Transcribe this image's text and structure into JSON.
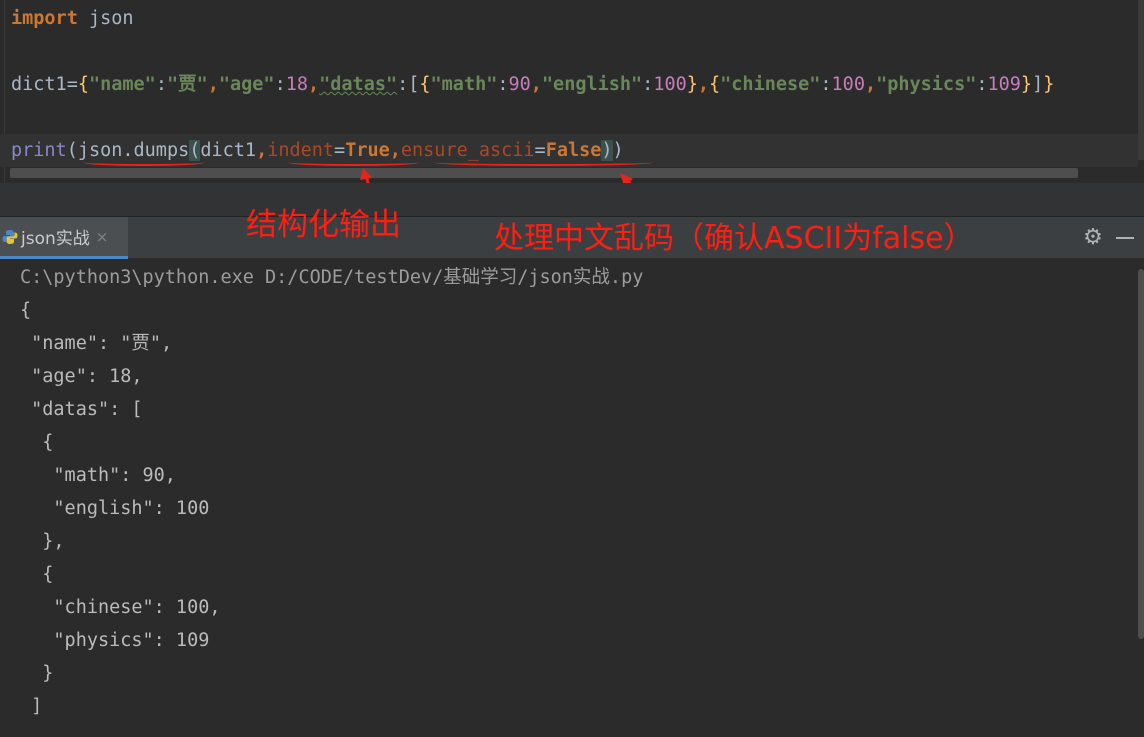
{
  "editor": {
    "line1": {
      "kw": "import",
      "mod": "json"
    },
    "line2": {
      "var": "dict1",
      "k_name": "\"name\"",
      "v_name": "\"贾\"",
      "k_age": "\"age\"",
      "v_age": "18",
      "k_datas": "\"datas\"",
      "k_math": "\"math\"",
      "v_math": "90",
      "k_english": "\"english\"",
      "v_english": "100",
      "k_chinese": "\"chinese\"",
      "v_chinese": "100",
      "k_physics": "\"physics\"",
      "v_physics": "109"
    },
    "line3": {
      "fn": "print",
      "call": "json.dumps",
      "arg": "dict1",
      "p_indent": "indent",
      "v_indent": "True",
      "p_ensure": "ensure_ascii",
      "v_ensure": "False"
    }
  },
  "annotations": {
    "structured_output": "结构化输出",
    "handle_chinese": "处理中文乱码（确认ASCII为false）",
    "color": "#ff1e12"
  },
  "run_panel": {
    "tab_label": "json实战",
    "tab_close": "×",
    "gear_icon": "gear-icon",
    "minimize_icon": "minimize-icon"
  },
  "console": {
    "command": "C:\\python3\\python.exe D:/CODE/testDev/基础学习/json实战.py",
    "lines": [
      "{",
      " \"name\": \"贾\",",
      " \"age\": 18,",
      " \"datas\": [",
      "  {",
      "   \"math\": 90,",
      "   \"english\": 100",
      "  },",
      "  {",
      "   \"chinese\": 100,",
      "   \"physics\": 109",
      "  }",
      " ]"
    ]
  }
}
